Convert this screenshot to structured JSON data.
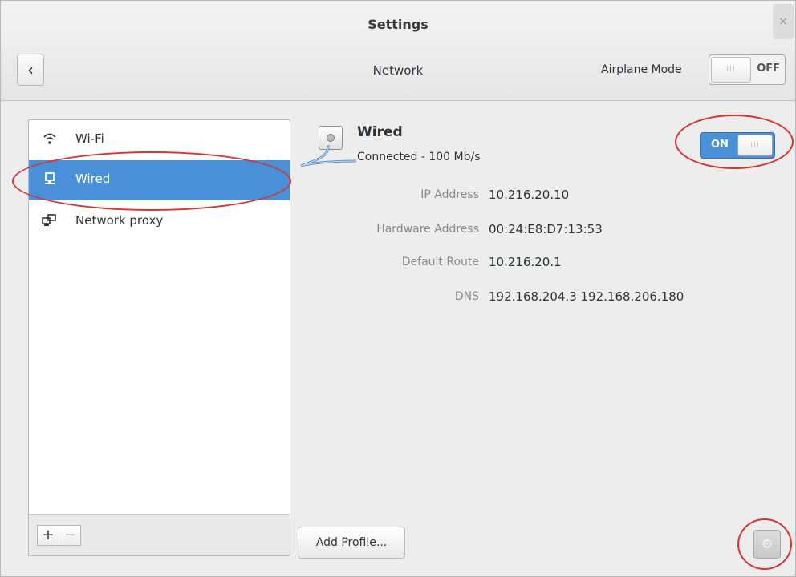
{
  "window": {
    "title": "Settings",
    "close_glyph": "×"
  },
  "header": {
    "back_glyph": "‹",
    "subtitle": "Network",
    "airplane_label": "Airplane Mode",
    "airplane_state": "OFF",
    "airplane_knob_glyph": "III"
  },
  "sidebar": {
    "items": [
      {
        "label": "Wi-Fi",
        "icon": "wifi-icon",
        "glyph": "ᯤ"
      },
      {
        "label": "Wired",
        "icon": "wired-icon",
        "glyph": "🖧"
      },
      {
        "label": "Network proxy",
        "icon": "network-proxy-icon",
        "glyph": "🖧"
      }
    ],
    "selected": "Wired",
    "add_glyph": "+",
    "remove_glyph": "−"
  },
  "device": {
    "name": "Wired",
    "status": "Connected - 100 Mb/s",
    "switch_state": "ON",
    "switch_knob_glyph": "III",
    "details": [
      {
        "label": "IP Address",
        "value": "10.216.20.10"
      },
      {
        "label": "Hardware Address",
        "value": "00:24:E8:D7:13:53"
      },
      {
        "label": "Default Route",
        "value": "10.216.20.1"
      },
      {
        "label": "DNS",
        "value": "192.168.204.3 192.168.206.180"
      }
    ]
  },
  "footer": {
    "add_profile_label": "Add Profile...",
    "gear_glyph": "⚙"
  },
  "colors": {
    "selection": "#4a90d9",
    "annotation": "#d83232"
  }
}
